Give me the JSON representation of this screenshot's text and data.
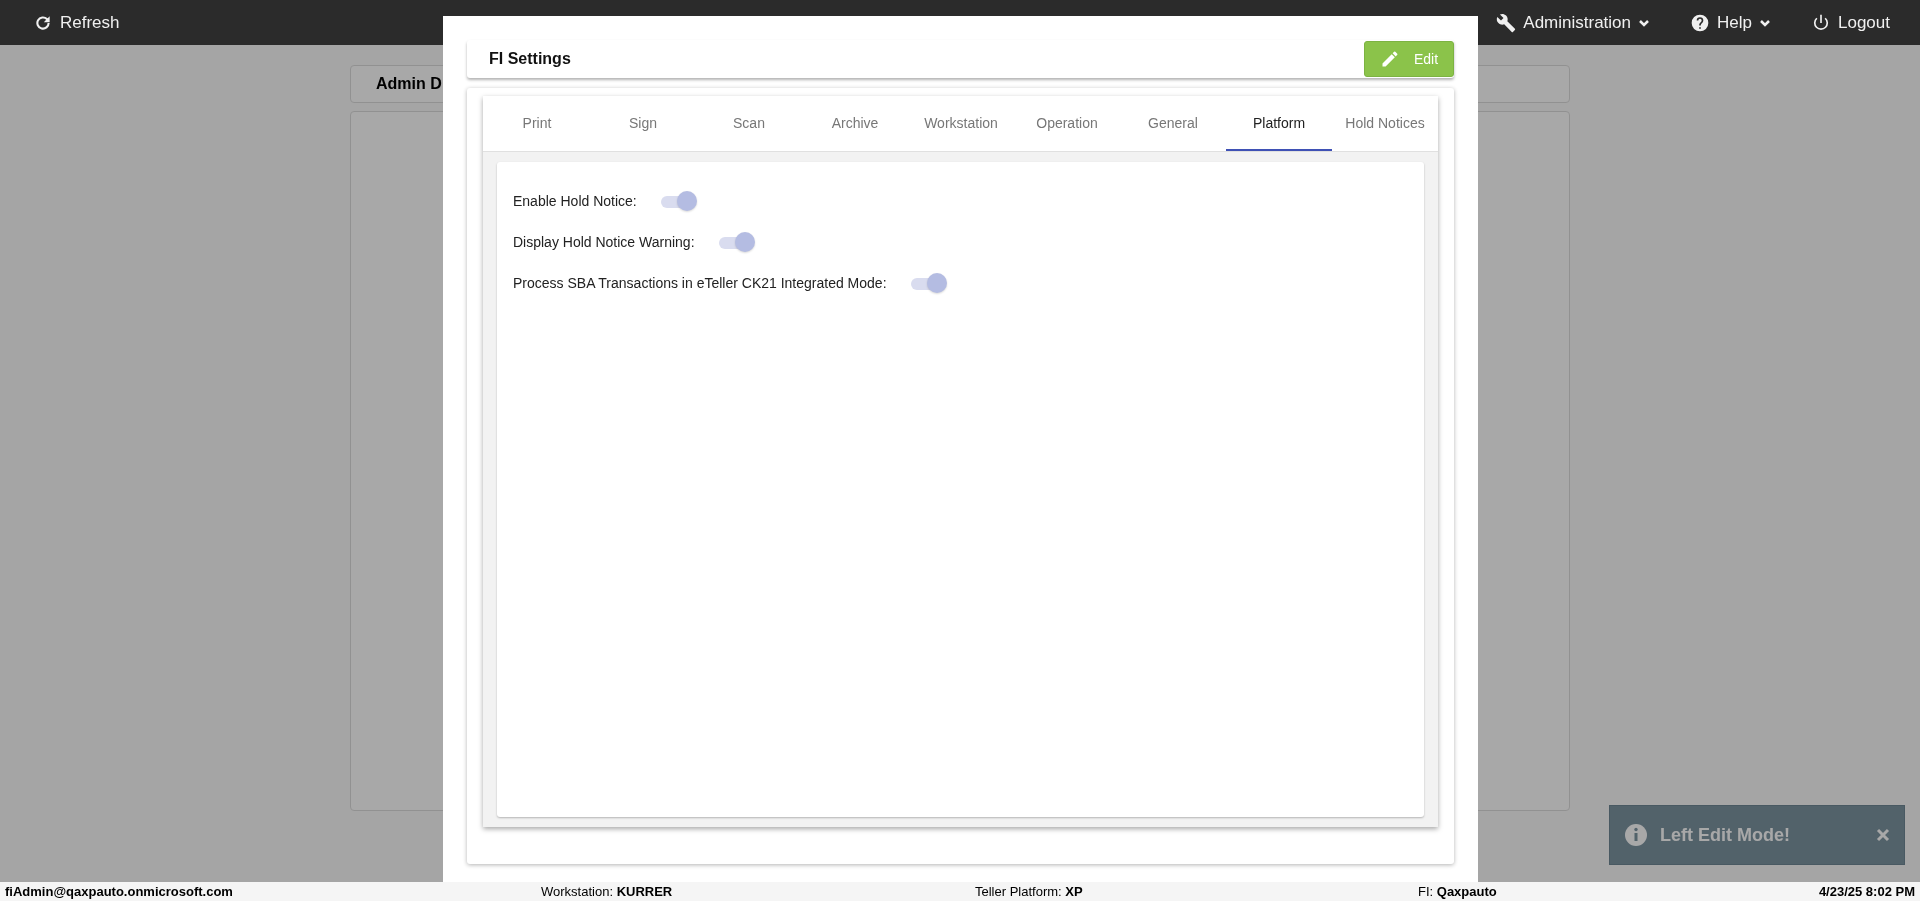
{
  "top_bar": {
    "refresh": "Refresh",
    "menus": [
      {
        "label": "Administration",
        "kind": "dropdown"
      },
      {
        "label": "Help",
        "kind": "dropdown"
      },
      {
        "label": "Logout",
        "kind": "link"
      }
    ]
  },
  "background": {
    "card_title": "Admin D"
  },
  "modal": {
    "title": "FI Settings",
    "edit_button": "Edit",
    "tabs": [
      {
        "label": "Print",
        "selected": false
      },
      {
        "label": "Sign",
        "selected": false
      },
      {
        "label": "Scan",
        "selected": false
      },
      {
        "label": "Archive",
        "selected": false
      },
      {
        "label": "Workstation",
        "selected": false
      },
      {
        "label": "Operation",
        "selected": false
      },
      {
        "label": "General",
        "selected": false
      },
      {
        "label": "Platform",
        "selected": true
      },
      {
        "label": "Hold Notices",
        "selected": false
      }
    ],
    "settings": [
      {
        "label": "Enable Hold Notice:",
        "on": true
      },
      {
        "label": "Display Hold Notice Warning:",
        "on": true
      },
      {
        "label": "Process SBA Transactions in eTeller CK21 Integrated Mode:",
        "on": true
      }
    ]
  },
  "toast": {
    "message": "Left Edit Mode!"
  },
  "status_bar": {
    "user": "fiAdmin@qaxpauto.onmicrosoft.com",
    "fields": [
      {
        "label": "Workstation:",
        "value": "KURRER"
      },
      {
        "label": "Teller Platform:",
        "value": "XP"
      },
      {
        "label": "FI:",
        "value": "Qaxpauto"
      }
    ],
    "datetime": "4/23/25 8:02 PM"
  }
}
